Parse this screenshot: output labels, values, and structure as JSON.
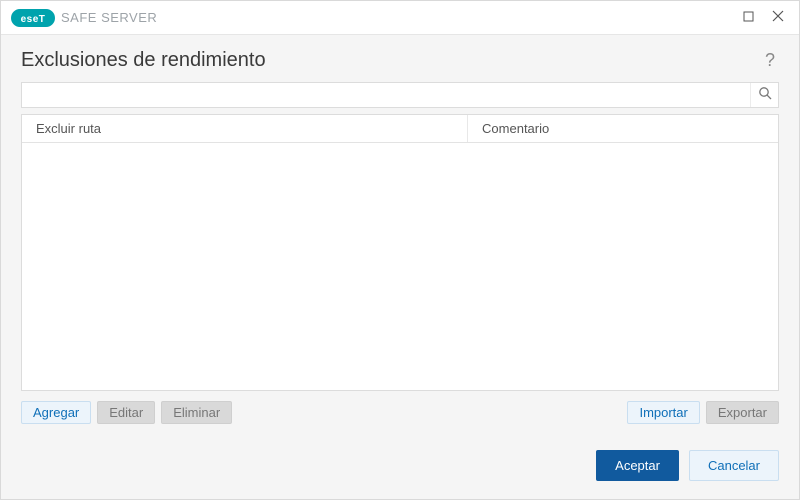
{
  "titlebar": {
    "brand_name": "SAFE SERVER"
  },
  "header": {
    "title": "Exclusiones de rendimiento",
    "help_symbol": "?"
  },
  "search": {
    "value": "",
    "placeholder": ""
  },
  "table": {
    "columns": {
      "path": "Excluir ruta",
      "comment": "Comentario"
    },
    "rows": []
  },
  "actions": {
    "add": "Agregar",
    "edit": "Editar",
    "delete": "Eliminar",
    "import": "Importar",
    "export": "Exportar"
  },
  "footer": {
    "accept": "Aceptar",
    "cancel": "Cancelar"
  }
}
